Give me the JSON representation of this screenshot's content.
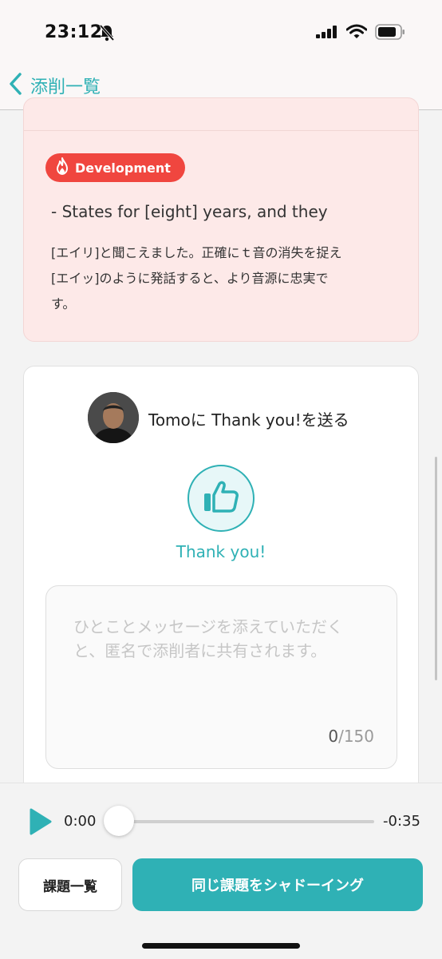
{
  "status_bar": {
    "time": "23:12",
    "icons": [
      "bell-slash-icon",
      "cellular-signal-icon",
      "wifi-icon",
      "battery-icon"
    ]
  },
  "nav": {
    "back_label": "添削一覧",
    "back_icon": "chevron-left-icon"
  },
  "feedback_card": {
    "badge_label": "Development",
    "badge_icon": "flame-icon",
    "sentence": "- States for [eight] years, and they",
    "feedback_lines": [
      "[エイリ]と聞こえました。正確にｔ音の消失を捉え",
      "[エイッ]のように発話すると、より音源に忠実で",
      "す。"
    ]
  },
  "thanks_card": {
    "title": "Tomoに Thank you!を送る",
    "thumb_label": "Thank you!",
    "thumb_icon": "thumbs-up-icon",
    "message_placeholder_lines": [
      "ひとことメッセージを添えていただく",
      "と、匿名で添削者に共有されます。"
    ],
    "char_count": "0",
    "char_max": "/150"
  },
  "player": {
    "current_time": "0:00",
    "remaining_time": "-0:35",
    "progress": 0,
    "play_icon": "play-icon"
  },
  "actions": {
    "list_button": "課題一覧",
    "shadowing_button": "同じ課題をシャドーイング"
  },
  "colors": {
    "accent": "#2fb1b5",
    "badge_red": "#f0463f",
    "card_pink": "#fde9e8"
  }
}
